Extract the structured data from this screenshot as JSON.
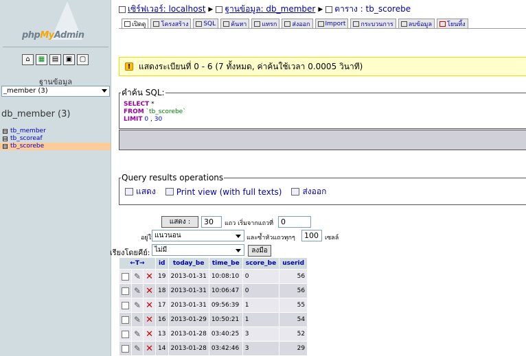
{
  "left": {
    "brand_php": "php",
    "brand_my": "My",
    "brand_admin": "Admin",
    "db_label": "ฐานข้อมูล",
    "db_selected": "_member (3)",
    "db_name": "db_member (3)",
    "tables": [
      "tb_member",
      "tb_scoreaf",
      "tb_scorebe"
    ]
  },
  "crumbs": {
    "server": "เซิร์ฟเวอร์: localhost",
    "database": "ฐานข้อมูล: db_member",
    "table": "ตาราง : tb_scorebe"
  },
  "tabs": [
    "เปิดดู",
    "โครงสร้าง",
    "SQL",
    "ค้นหา",
    "แทรก",
    "ส่งออก",
    "Import",
    "กระบวนการ",
    "ลบข้อมูล",
    "โยนทิ้ง"
  ],
  "notice": "แสดงระเบียนที่ 0 - 6 (7 ทั้งหมด, ค่าค้นใช้เวลา 0.0005 วินาที)",
  "sql": {
    "legend": "คำค้น SQL:",
    "select_kw": "SELECT",
    "select_rest": " *",
    "from_kw": "FROM",
    "from_table": " `tb_scorebe`",
    "limit_kw": "LIMIT",
    "limit_a": " 0",
    "limit_b": "30"
  },
  "qro": {
    "legend": "Query results operations",
    "print": "แสดง",
    "print_full": "Print view (with full texts)",
    "export": "ส่งออก"
  },
  "nav": {
    "show_button": "แสดง :",
    "rows": "30",
    "rows_label": "แถว เริ่มจากแถวที่",
    "start": "0",
    "mode_label": "อยู่ใน",
    "mode": "แนวนอน",
    "repeat_label": "และซ้ำหัวแถวทุกๆ",
    "repeat": "100",
    "cells_label": "เซลล์",
    "sort_label": "เรียงโดยคีย์:",
    "sort_value": "ไม่มี",
    "go_button": "ลงมือ"
  },
  "table": {
    "headers": [
      "id",
      "today_be",
      "time_be",
      "score_be",
      "userid"
    ],
    "rows": [
      [
        "19",
        "2013-01-31",
        "10:08:10",
        "0",
        "56"
      ],
      [
        "18",
        "2013-01-31",
        "10:06:47",
        "0",
        "56"
      ],
      [
        "17",
        "2013-01-31",
        "09:56:39",
        "1",
        "55"
      ],
      [
        "16",
        "2013-01-29",
        "10:50:21",
        "1",
        "54"
      ],
      [
        "13",
        "2013-01-28",
        "03:40:25",
        "3",
        "52"
      ],
      [
        "14",
        "2013-01-28",
        "03:42:46",
        "3",
        "29"
      ]
    ]
  }
}
